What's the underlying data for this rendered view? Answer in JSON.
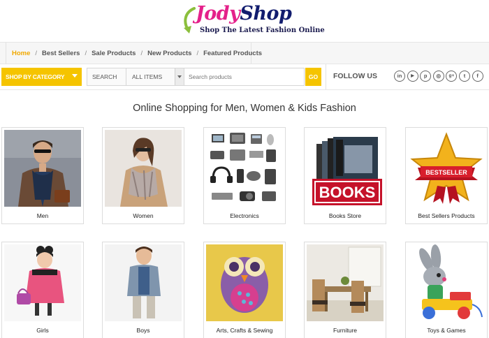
{
  "logo": {
    "word_part1": "Jody",
    "word_part2": "Shop",
    "tagline": "Shop The Latest Fashion Online"
  },
  "nav": {
    "items": [
      {
        "label": "Home",
        "active": true
      },
      {
        "label": "Best Sellers"
      },
      {
        "label": "Sale Products"
      },
      {
        "label": "New Products"
      },
      {
        "label": "Featured Products"
      }
    ],
    "separator": "/"
  },
  "search": {
    "category_button": "SHOP BY CATEGORY",
    "label": "SEARCH",
    "select_value": "ALL ITEMS",
    "placeholder": "Search products",
    "go": "GO"
  },
  "follow": {
    "label": "FOLLOW US",
    "icons": [
      {
        "name": "linkedin-icon",
        "glyph": "in"
      },
      {
        "name": "youtube-icon",
        "glyph": "▶"
      },
      {
        "name": "pinterest-icon",
        "glyph": "p"
      },
      {
        "name": "instagram-icon",
        "glyph": "◎"
      },
      {
        "name": "google-plus-icon",
        "glyph": "g+"
      },
      {
        "name": "twitter-icon",
        "glyph": "t"
      },
      {
        "name": "facebook-icon",
        "glyph": "f"
      }
    ]
  },
  "heading": "Online Shopping for Men, Women & Kids Fashion",
  "categories": [
    {
      "label": "Men",
      "icon": "men-image"
    },
    {
      "label": "Women",
      "icon": "women-image"
    },
    {
      "label": "Electronics",
      "icon": "electronics-image"
    },
    {
      "label": "Books Store",
      "icon": "books-image"
    },
    {
      "label": "Best Sellers Products",
      "icon": "bestseller-image"
    },
    {
      "label": "Girls",
      "icon": "girls-image"
    },
    {
      "label": "Boys",
      "icon": "boys-image"
    },
    {
      "label": "Arts, Crafts & Sewing",
      "icon": "arts-crafts-image"
    },
    {
      "label": "Furniture",
      "icon": "furniture-image"
    },
    {
      "label": "Toys & Games",
      "icon": "toys-image"
    }
  ],
  "badges": {
    "books": "BOOKS",
    "bestseller": "BESTSELLER"
  },
  "colors": {
    "accent": "#f5c400",
    "nav_active": "#f0a800",
    "logo_pink": "#e4218a",
    "logo_navy": "#111c6e"
  }
}
